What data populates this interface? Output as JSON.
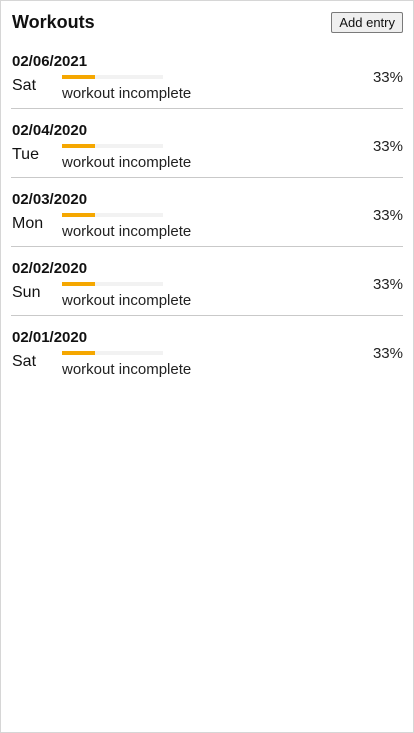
{
  "header": {
    "title": "Workouts",
    "add_button_label": "Add entry"
  },
  "colors": {
    "progress_fill": "#f5a700",
    "divider": "#c9c9c9"
  },
  "workouts": [
    {
      "date": "02/06/2021",
      "day": "Sat",
      "status": "workout incomplete",
      "percent_label": "33%",
      "progress": 0.33
    },
    {
      "date": "02/04/2020",
      "day": "Tue",
      "status": "workout incomplete",
      "percent_label": "33%",
      "progress": 0.33
    },
    {
      "date": "02/03/2020",
      "day": "Mon",
      "status": "workout incomplete",
      "percent_label": "33%",
      "progress": 0.33
    },
    {
      "date": "02/02/2020",
      "day": "Sun",
      "status": "workout incomplete",
      "percent_label": "33%",
      "progress": 0.33
    },
    {
      "date": "02/01/2020",
      "day": "Sat",
      "status": "workout incomplete",
      "percent_label": "33%",
      "progress": 0.33
    }
  ]
}
